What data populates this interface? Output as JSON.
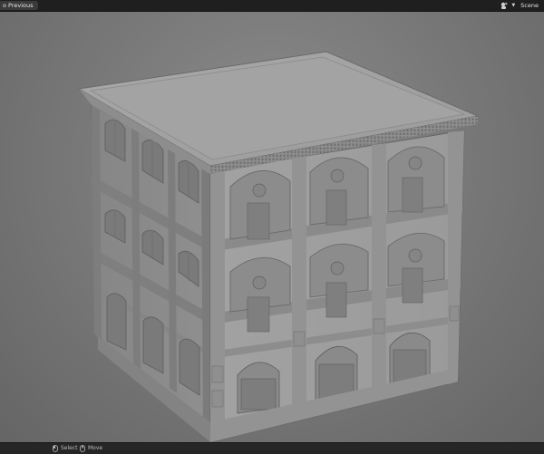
{
  "header": {
    "previous_label": "o Previous",
    "scene_label": "Scene",
    "scene_icon": "scene-icon"
  },
  "statusbar": {
    "select_label": "Select",
    "move_label": "Move",
    "select_icon": "mouse-left-icon",
    "move_icon": "mouse-middle-icon"
  },
  "viewport": {
    "background_color": "#7a7a7a",
    "model_color": "#9a9a9a"
  }
}
